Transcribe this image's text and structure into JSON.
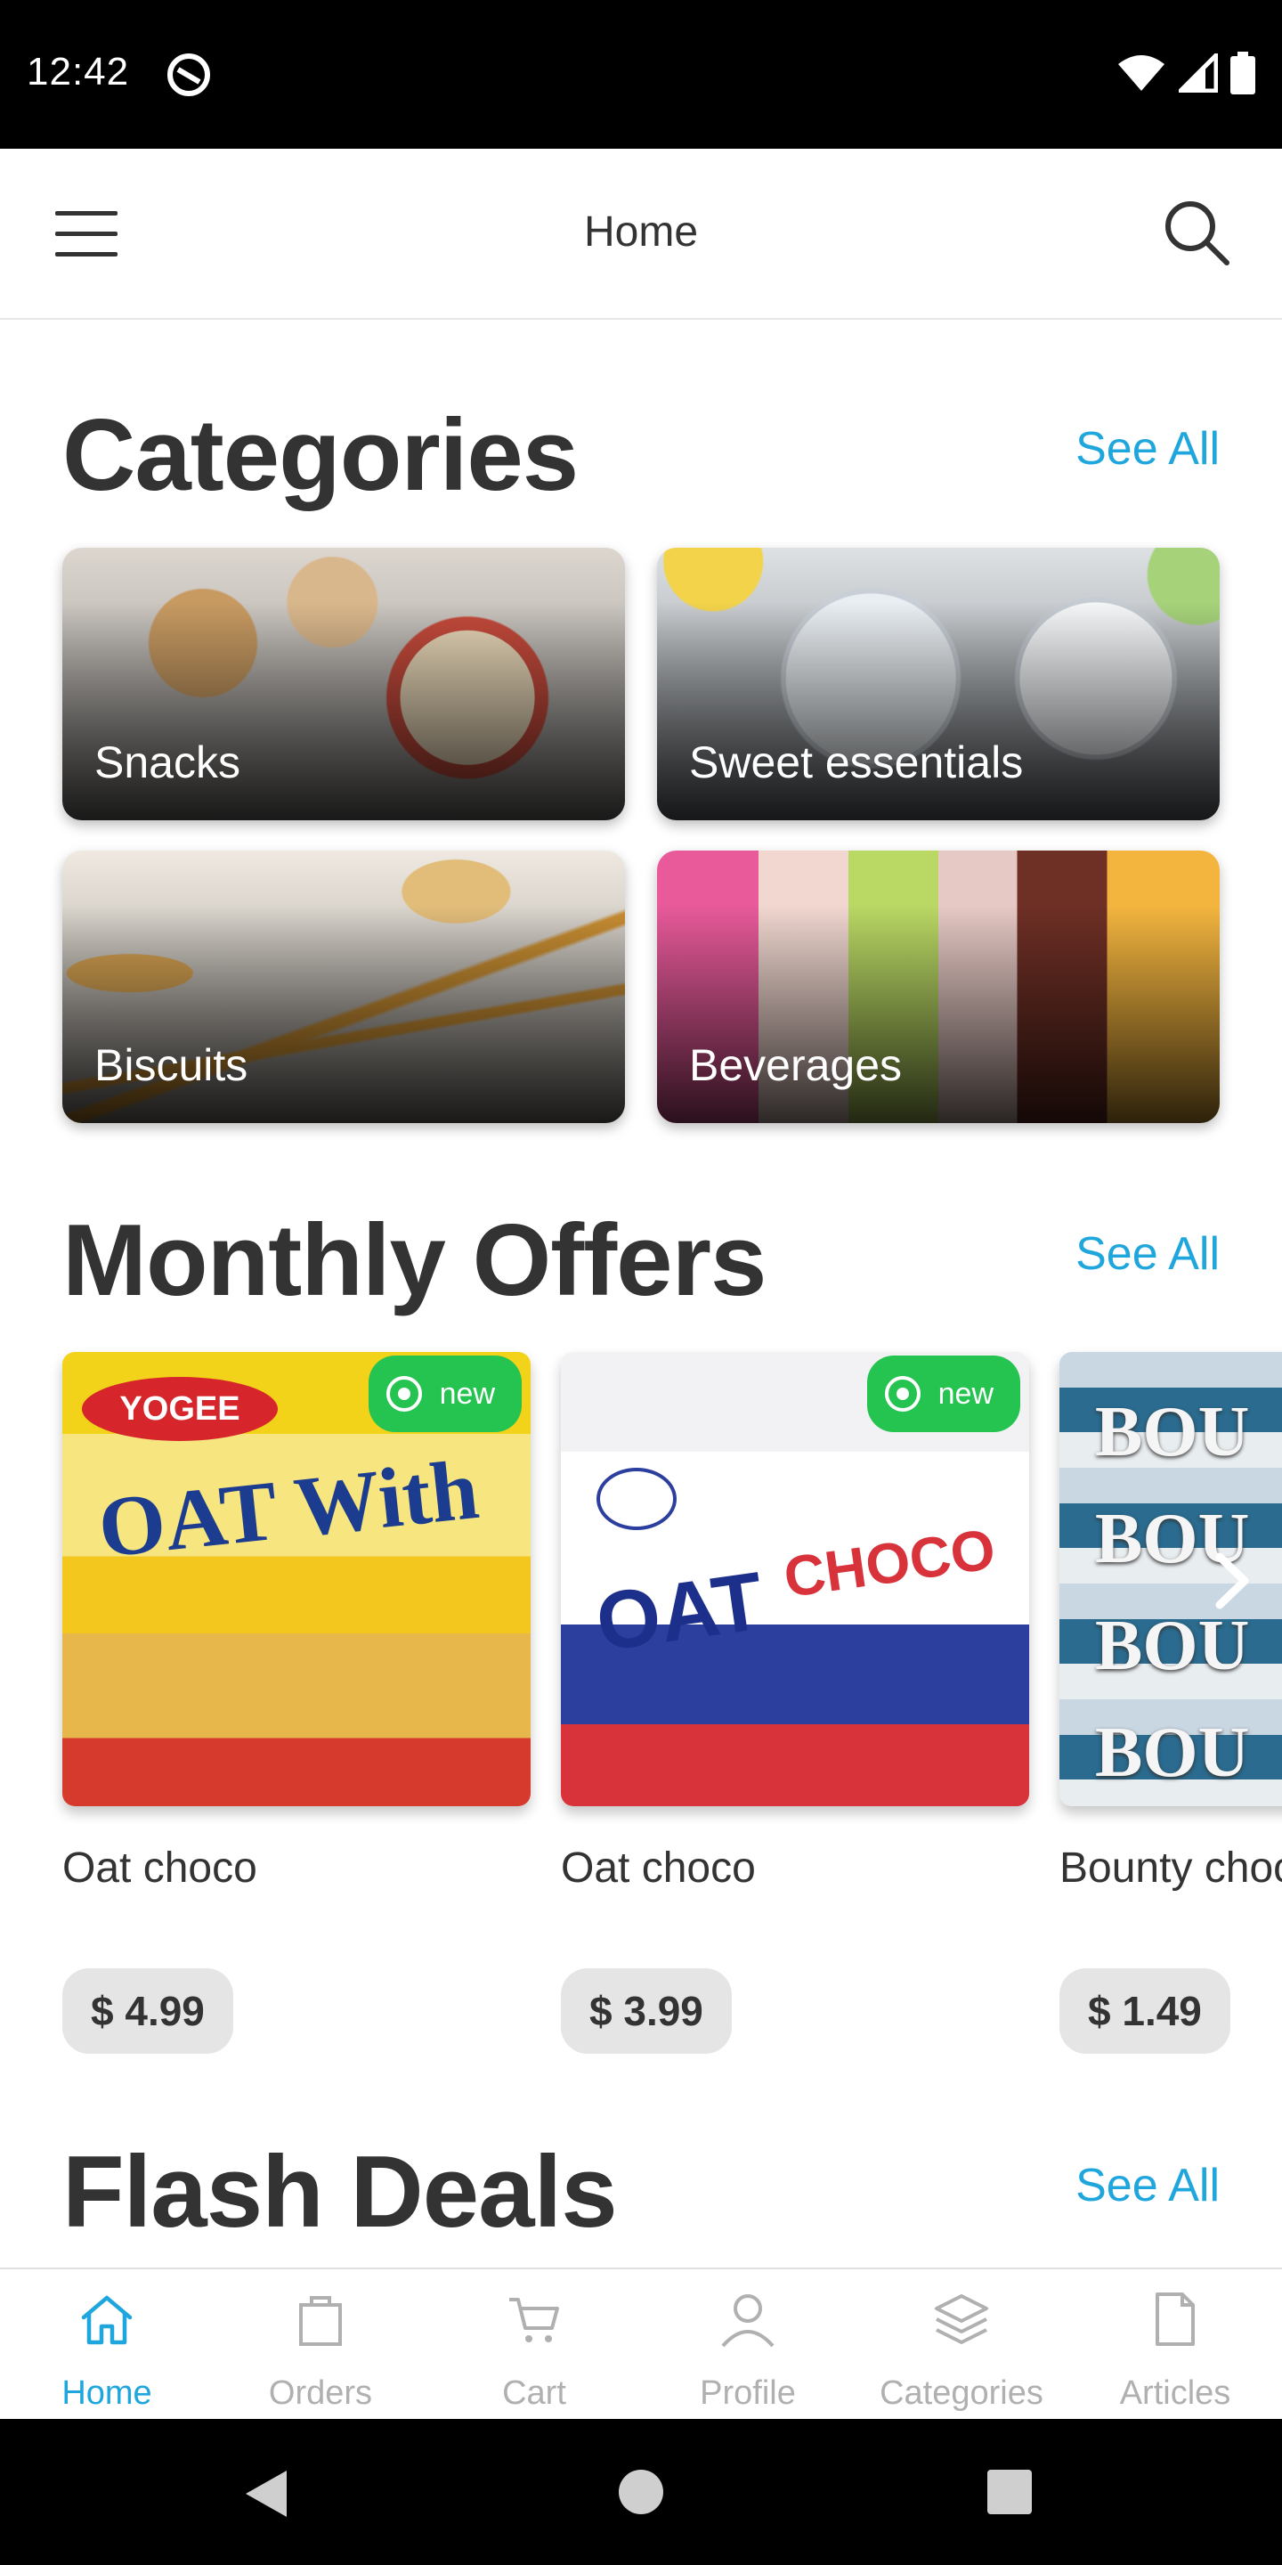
{
  "status_bar": {
    "time": "12:42"
  },
  "app_bar": {
    "title": "Home"
  },
  "categories": {
    "title": "Categories",
    "see_all": "See All",
    "items": [
      {
        "label": "Snacks"
      },
      {
        "label": "Sweet essentials"
      },
      {
        "label": "Biscuits"
      },
      {
        "label": "Beverages"
      }
    ]
  },
  "monthly_offers": {
    "title": "Monthly Offers",
    "see_all": "See All",
    "items": [
      {
        "name": "Oat choco",
        "price": "$ 4.99",
        "badge": "new"
      },
      {
        "name": "Oat choco",
        "price": "$ 3.99",
        "badge": "new"
      },
      {
        "name": "Bounty choco",
        "price": "$ 1.49"
      }
    ]
  },
  "flash_deals": {
    "title": "Flash Deals",
    "see_all": "See All"
  },
  "bottom_nav": {
    "items": [
      {
        "label": "Home",
        "icon": "home-icon",
        "active": true
      },
      {
        "label": "Orders",
        "icon": "bag-icon"
      },
      {
        "label": "Cart",
        "icon": "cart-icon"
      },
      {
        "label": "Profile",
        "icon": "profile-icon"
      },
      {
        "label": "Categories",
        "icon": "layers-icon"
      },
      {
        "label": "Articles",
        "icon": "document-icon"
      }
    ]
  },
  "colors": {
    "accent": "#1fa6dc",
    "badge": "#25c350",
    "text": "#333333"
  }
}
